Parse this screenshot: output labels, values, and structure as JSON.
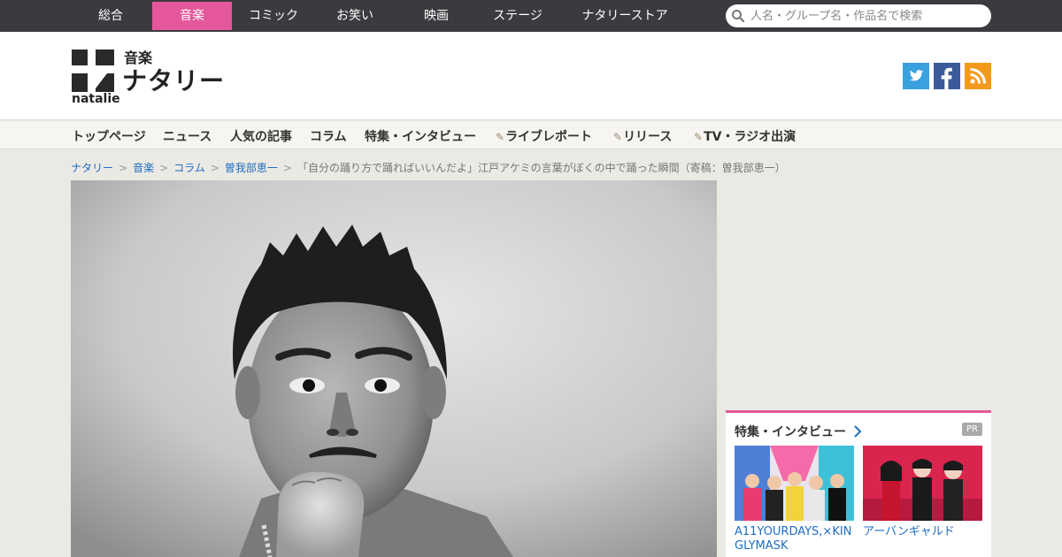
{
  "genres": [
    {
      "label": "総合",
      "active": false
    },
    {
      "label": "音楽",
      "active": true
    },
    {
      "label": "コミック",
      "active": false
    },
    {
      "label": "お笑い",
      "active": false
    },
    {
      "label": "映画",
      "active": false
    },
    {
      "label": "ステージ",
      "active": false
    },
    {
      "label": "ナタリーストア",
      "active": false
    }
  ],
  "search": {
    "placeholder": "人名・グループ名・作品名で検索",
    "icon": "search-icon"
  },
  "logo": {
    "sub": "音楽",
    "main": "ナタリー",
    "en": "natalie"
  },
  "social": [
    {
      "name": "twitter-icon",
      "color": "#3aa1df"
    },
    {
      "name": "facebook-icon",
      "color": "#3b5a9a"
    },
    {
      "name": "rss-icon",
      "color": "#f39a1e"
    }
  ],
  "accent_color": "#e4579a",
  "subnav": [
    {
      "label": "トップページ",
      "pencil": false
    },
    {
      "label": "ニュース",
      "pencil": false
    },
    {
      "label": "人気の記事",
      "pencil": false
    },
    {
      "label": "コラム",
      "pencil": false
    },
    {
      "label": "特集・インタビュー",
      "pencil": false
    },
    {
      "label": "ライブレポート",
      "pencil": true
    },
    {
      "label": "リリース",
      "pencil": true
    },
    {
      "label": "TV・ラジオ出演",
      "pencil": true
    }
  ],
  "breadcrumb": {
    "links": [
      "ナタリー",
      "音楽",
      "コラム",
      "曽我部恵一"
    ],
    "current": "「自分の踊り方で踊ればいいんだよ」江戸アケミの言葉がぼくの中で踊った瞬間（寄稿：曽我部恵一）"
  },
  "sidebar": {
    "title": "特集・インタビュー",
    "badge": "PR",
    "cards": [
      {
        "title": "A11YOURDAYS,×KINGLYMASK"
      },
      {
        "title": "アーバンギャルド"
      }
    ]
  }
}
